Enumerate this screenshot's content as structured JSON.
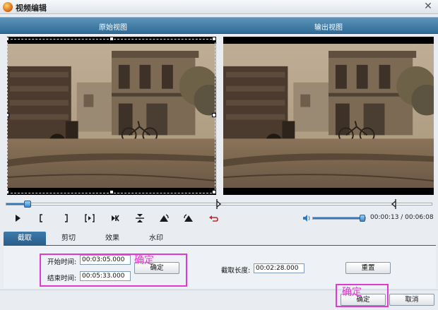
{
  "window": {
    "title": "视频编辑",
    "close_symbol": "✕"
  },
  "header": {
    "original_view": "原始视图",
    "output_view": "输出视图"
  },
  "playback": {
    "progress_fraction": 0.05,
    "start_marker_fraction": 0.495,
    "end_marker_fraction": 0.915,
    "volume_fraction": 0.95,
    "time_readout": "00:00:13 / 00:06:08",
    "controls": [
      "play-icon",
      "mark-in-icon",
      "mark-out-icon",
      "next-frame-icon",
      "skip-to-end-icon",
      "flip-vertical-icon",
      "rotate-left-icon",
      "rotate-right-icon",
      "undo-icon"
    ]
  },
  "tabs": [
    {
      "label": "截取",
      "active": true
    },
    {
      "label": "剪切",
      "active": false
    },
    {
      "label": "效果",
      "active": false
    },
    {
      "label": "水印",
      "active": false
    }
  ],
  "trim": {
    "start_label": "开始时间:",
    "start_value": "00:03:05.000",
    "end_label": "结束时间:",
    "end_value": "00:05:33.000",
    "confirm_label": "确定",
    "length_label": "截取长度:",
    "length_value": "00:02:28.000",
    "reset_label": "重置"
  },
  "footer": {
    "ok_label": "确定",
    "cancel_label": "取消"
  },
  "annotations": {
    "trim_note": "确定",
    "ok_note": "确定"
  },
  "colors": {
    "accent": "#2e7bc4",
    "header": "#3a74a0",
    "annotation": "#e23ad0"
  }
}
